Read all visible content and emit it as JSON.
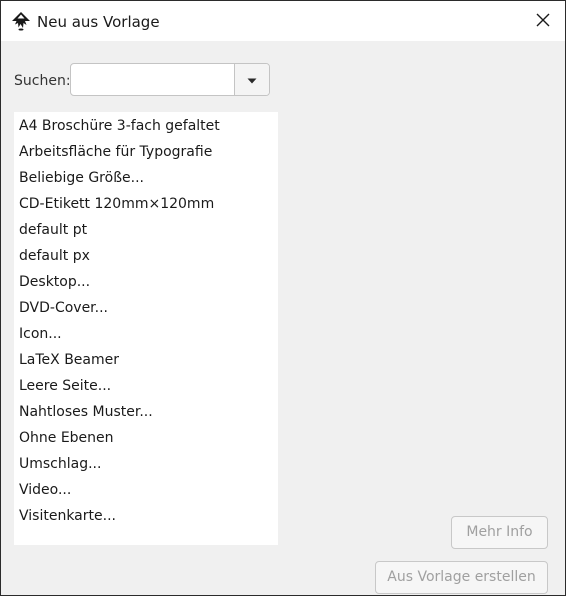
{
  "window": {
    "title": "Neu aus Vorlage",
    "icon": "inkscape-logo-icon",
    "close_icon": "close-icon"
  },
  "search": {
    "label": "Suchen:",
    "value": "",
    "placeholder": "",
    "dropdown_icon": "chevron-down-icon"
  },
  "templates": [
    "A4 Broschüre 3-fach gefaltet",
    "Arbeitsfläche für Typografie",
    "Beliebige Größe...",
    "CD-Etikett 120mm×120mm",
    "default pt",
    "default px",
    "Desktop...",
    "DVD-Cover...",
    "Icon...",
    "LaTeX Beamer",
    "Leere Seite...",
    "Nahtloses Muster...",
    "Ohne Ebenen",
    "Umschlag...",
    "Video...",
    "Visitenkarte..."
  ],
  "buttons": {
    "more_info": "Mehr Info",
    "create_from_template": "Aus Vorlage erstellen"
  }
}
